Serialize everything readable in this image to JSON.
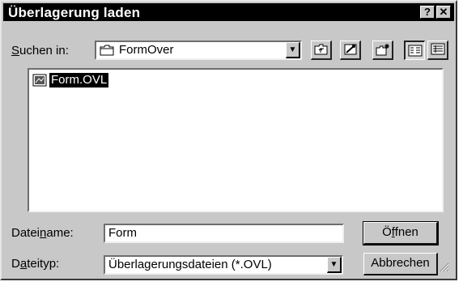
{
  "dialog": {
    "title": "Überlagerung laden",
    "help_label": "?",
    "close_label": "✕"
  },
  "look_in": {
    "label_prefix": "S",
    "label_rest": "uchen in:",
    "value": "FormOver"
  },
  "toolbar": {
    "icons": [
      "up-folder-icon",
      "favorites-icon",
      "new-folder-icon",
      "list-view-icon",
      "details-view-icon"
    ]
  },
  "file_list": {
    "items": [
      {
        "name": "Form.OVL",
        "selected": true
      }
    ]
  },
  "file_name": {
    "label_a": "Datei",
    "label_u": "n",
    "label_b": "ame:",
    "value": "Form"
  },
  "file_type": {
    "label_a": "D",
    "label_u": "a",
    "label_b": "teityp:",
    "value": "Überlagerungsdateien (*.OVL)"
  },
  "buttons": {
    "open_a": "Ö",
    "open_u": "f",
    "open_b": "fnen",
    "cancel": "Abbrechen"
  }
}
